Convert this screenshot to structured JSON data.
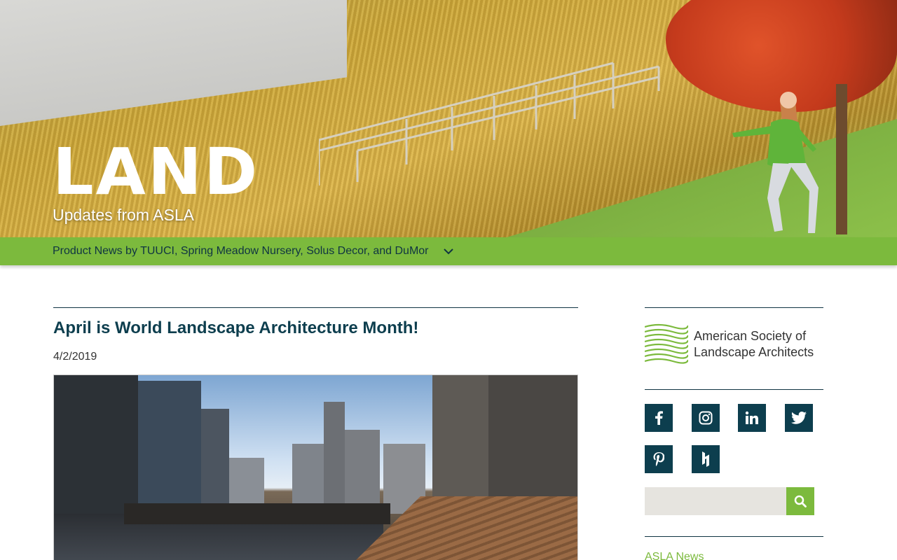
{
  "hero": {
    "title": "LAND",
    "subtitle": "Updates from ASLA"
  },
  "nav": {
    "current_post": "Product News by TUUCI, Spring Meadow Nursery, Solus Decor, and DuMor",
    "chevron_icon": "chevron-down-icon"
  },
  "post": {
    "title": "April is World Landscape Architecture Month!",
    "date": "4/2/2019"
  },
  "sidebar": {
    "logo_line1": "American Society of",
    "logo_line2": "Landscape Architects",
    "social": [
      {
        "name": "facebook-icon",
        "glyph": "f"
      },
      {
        "name": "instagram-icon",
        "glyph": "◎"
      },
      {
        "name": "linkedin-icon",
        "glyph": "in"
      },
      {
        "name": "twitter-icon",
        "glyph": "🐦"
      },
      {
        "name": "pinterest-icon",
        "glyph": "P"
      },
      {
        "name": "houzz-icon",
        "glyph": "h"
      }
    ],
    "search_placeholder": "",
    "search_icon": "search-icon",
    "section_link": "ASLA News"
  },
  "colors": {
    "brand_green": "#7cba3d",
    "brand_navy": "#0d3e4e",
    "search_bg": "#e6e4df"
  }
}
